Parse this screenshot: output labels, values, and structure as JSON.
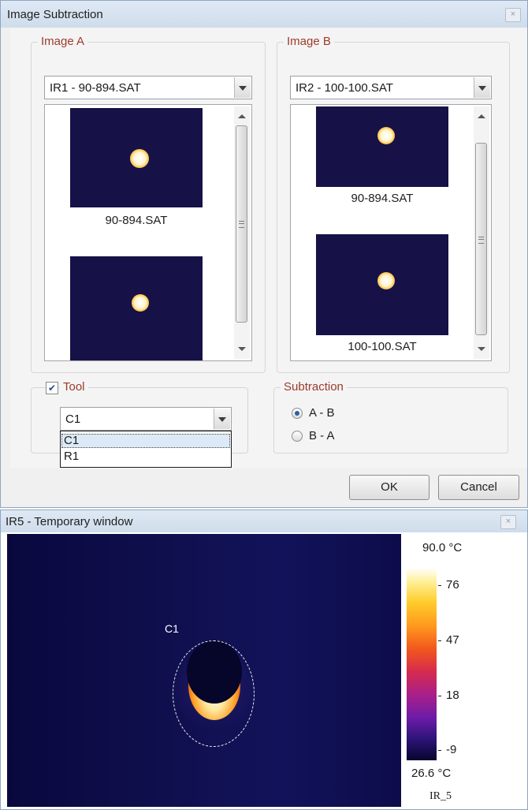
{
  "dialog": {
    "title": "Image Subtraction",
    "close_glyph": "×",
    "image_a": {
      "label": "Image A",
      "selected": "IR1 - 90-894.SAT",
      "thumbnails": [
        {
          "caption": "90-894.SAT"
        }
      ]
    },
    "image_b": {
      "label": "Image B",
      "selected": "IR2 - 100-100.SAT",
      "thumbnails": [
        {
          "caption": "90-894.SAT"
        },
        {
          "caption": "100-100.SAT"
        }
      ]
    },
    "tool": {
      "label": "Tool",
      "checked": true,
      "check_glyph": "✔",
      "selected": "C1",
      "options": [
        "C1",
        "R1"
      ]
    },
    "subtraction": {
      "label": "Subtraction",
      "options": [
        "A - B",
        "B - A"
      ],
      "selected": "A - B"
    },
    "buttons": {
      "ok": "OK",
      "cancel": "Cancel"
    }
  },
  "temp_window": {
    "title": "IR5 - Temporary window",
    "close_glyph": "×",
    "roi_label": "C1",
    "colorbar": {
      "max_label": "90.0 °C",
      "min_label": "26.6 °C",
      "ticks": [
        "76",
        "47",
        "18",
        "-9"
      ],
      "unit_label": "IR_5"
    }
  },
  "colors": {
    "group_label": "#9d3a2b",
    "thumb_bg": "#161147",
    "selection": "#dceaf7"
  }
}
